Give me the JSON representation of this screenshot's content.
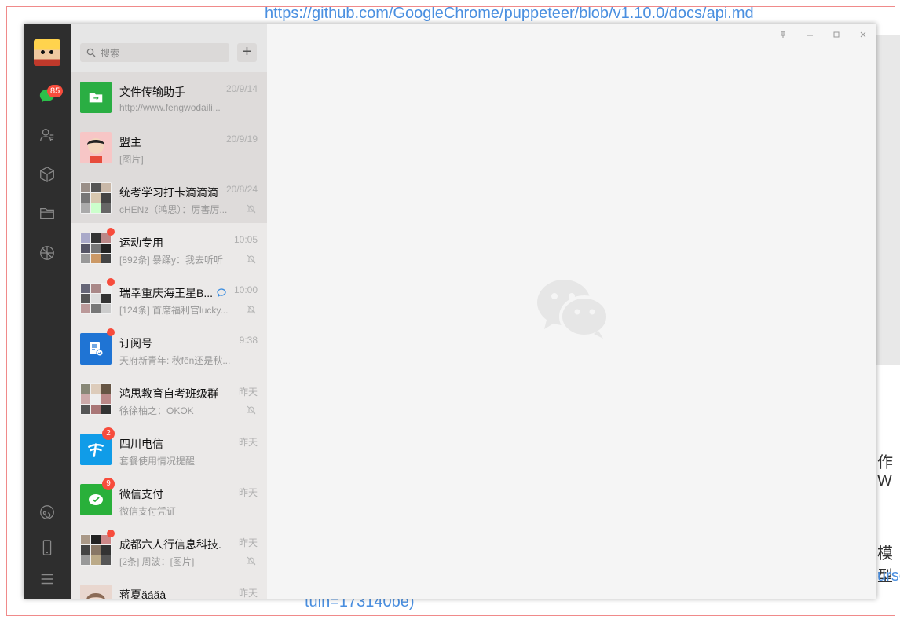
{
  "background": {
    "url_text": "https://github.com/GoogleChrome/puppeteer/blob/v1.10.0/docs/api.md",
    "bottom_text": "tuin=173140be)",
    "right_text_1": "作W",
    "right_text_2": "模型",
    "right_text_3": "urse"
  },
  "nav": {
    "chat_badge": "85",
    "icons": [
      "chat-icon",
      "contacts-icon",
      "favorites-icon",
      "files-icon",
      "moments-icon",
      "mini-program-icon",
      "phone-icon",
      "menu-icon"
    ]
  },
  "search": {
    "placeholder": "搜索",
    "add_label": "+"
  },
  "chats": [
    {
      "name": "文件传输助手",
      "time": "20/9/14",
      "msg": "http://www.fengwodaili...",
      "muted": false
    },
    {
      "name": "盟主",
      "time": "20/9/19",
      "msg": "[图片]",
      "muted": false
    },
    {
      "name": "统考学习打卡滴滴滴",
      "time": "20/8/24",
      "msg": "cHENz（鸿思）：厉害厉...",
      "muted": true
    },
    {
      "name": "运动专用",
      "time": "10:05",
      "msg": "[892条] 暴躁y：我去听听",
      "muted": true
    },
    {
      "name": "瑞幸重庆海王星B...",
      "time": "10:00",
      "msg": "[124条] 首席福利官lucky...",
      "muted": true
    },
    {
      "name": "订阅号",
      "time": "9:38",
      "msg": "天府新青年: 秋fēn还是秋...",
      "muted": false
    },
    {
      "name": "鸿思教育自考班级群",
      "time": "昨天",
      "msg": "徐徐柚之：OKOK",
      "muted": true
    },
    {
      "name": "四川电信",
      "time": "昨天",
      "msg": "套餐使用情况提醒",
      "muted": false,
      "badge": "2"
    },
    {
      "name": "微信支付",
      "time": "昨天",
      "msg": "微信支付凭证",
      "muted": false,
      "badge": "9"
    },
    {
      "name": "成都六人行信息科技...",
      "time": "昨天",
      "msg": "[2条] 周波：[图片]",
      "muted": true
    },
    {
      "name": "蒋夏ǎáǎà",
      "time": "昨天",
      "msg": "",
      "muted": false
    }
  ],
  "colors": {
    "nav_bg": "#2e2e2e",
    "list_bg": "#e6e6e6",
    "main_bg": "#f5f5f5",
    "badge": "#f74c3c",
    "wechat_green": "#29b03a"
  }
}
